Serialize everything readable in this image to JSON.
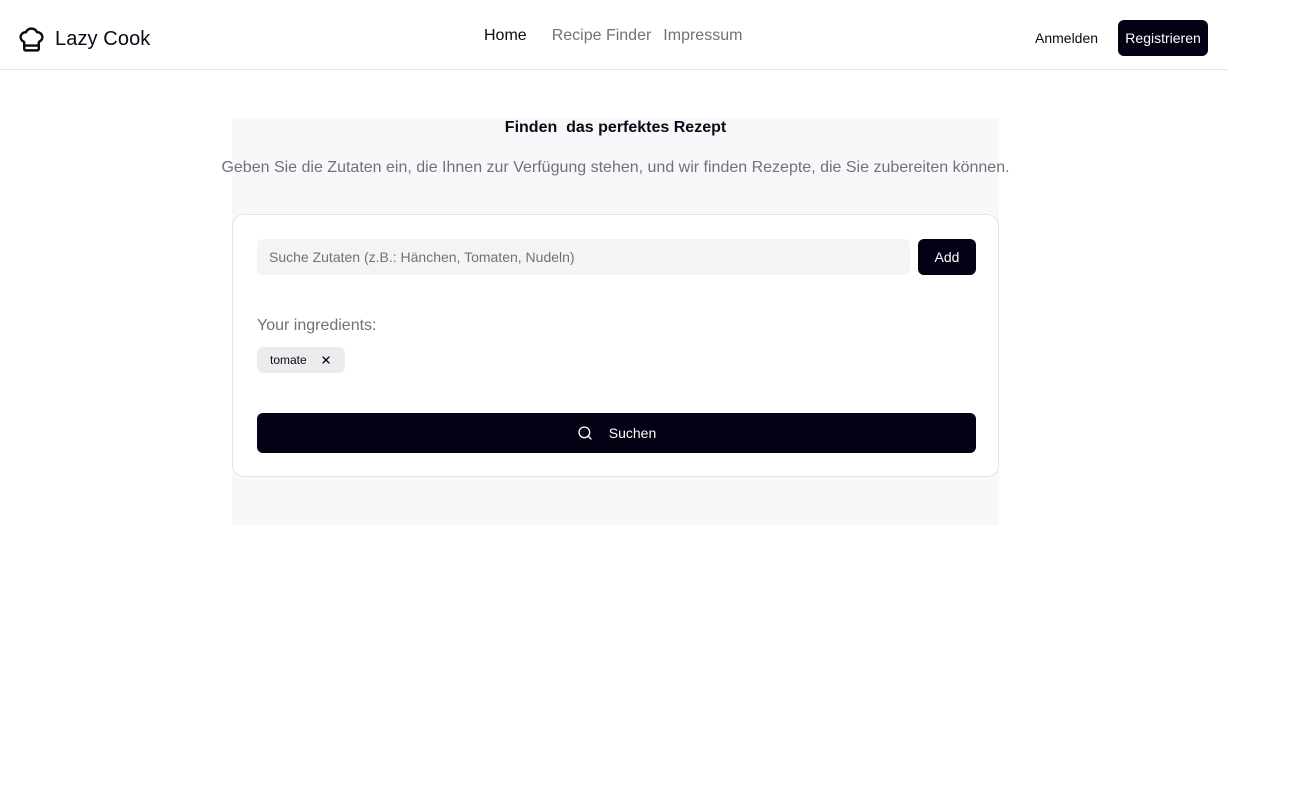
{
  "app": {
    "name": "Lazy Cook",
    "logo_icon": "chef-hat-icon"
  },
  "nav": {
    "items": [
      {
        "label": "Home",
        "active": true
      },
      {
        "label": "Recipe Finder",
        "active": false
      },
      {
        "label": "Impressum",
        "active": false
      }
    ]
  },
  "auth": {
    "login_label": "Anmelden",
    "register_label": "Registrieren"
  },
  "hero": {
    "title": "Finden  das perfektes Rezept",
    "subtitle": "Geben Sie die Zutaten ein, die Ihnen zur Verfügung stehen, und wir finden Rezepte, die Sie zubereiten können."
  },
  "finder": {
    "input_value": "",
    "input_placeholder": "Suche Zutaten (z.B.: Hänchen, Tomaten, Nudeln)",
    "add_label": "Add",
    "ingredients_label": "Your ingredients:",
    "ingredients": [
      {
        "name": "tomate",
        "remove_icon": "close-icon"
      }
    ],
    "search_label": "Suchen",
    "search_icon": "search-icon"
  },
  "colors": {
    "primary": "#020214",
    "muted_text": "#71717a",
    "hero_background": "#f8f8fa",
    "input_background": "#f4f4f5",
    "chip_background": "#ececef",
    "border": "#e4e4e7"
  }
}
